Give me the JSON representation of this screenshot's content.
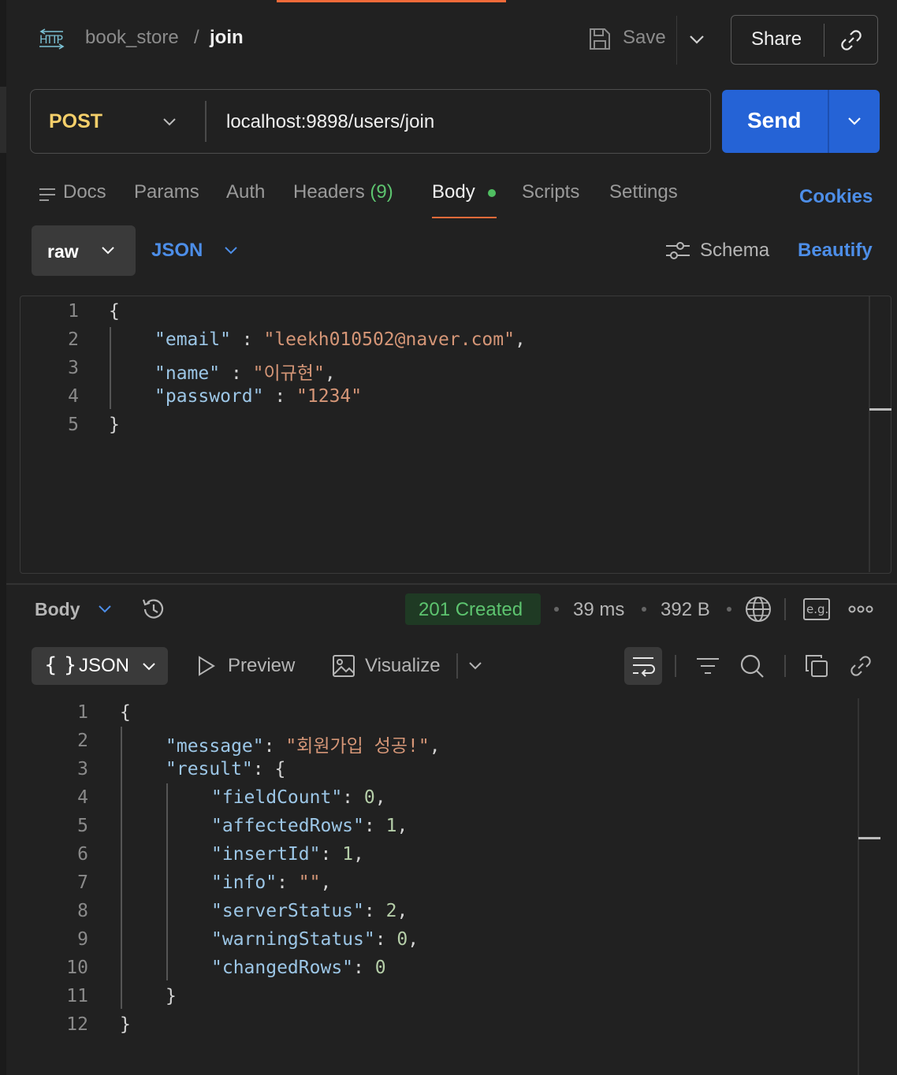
{
  "header": {
    "collection": "book_store",
    "separator": "/",
    "request_name": "join",
    "save_label": "Save",
    "share_label": "Share",
    "protocol_icon": "HTTP"
  },
  "request": {
    "method": "POST",
    "url": "localhost:9898/users/join",
    "send_label": "Send"
  },
  "tabs": {
    "docs": "Docs",
    "params": "Params",
    "auth": "Auth",
    "headers": "Headers",
    "headers_count": "(9)",
    "body": "Body",
    "scripts": "Scripts",
    "settings": "Settings",
    "cookies": "Cookies"
  },
  "body_options": {
    "mode": "raw",
    "format": "JSON",
    "schema": "Schema",
    "beautify": "Beautify"
  },
  "request_body": {
    "line_numbers": [
      "1",
      "2",
      "3",
      "4",
      "5"
    ],
    "lines": {
      "l1": "{",
      "email_key": "\"email\"",
      "email_sep": " : ",
      "email_val": "\"leekh010502@naver.com\"",
      "email_comma": ",",
      "name_key": "\"name\"",
      "name_sep": " : ",
      "name_val": "\"이규현\"",
      "name_comma": ",",
      "pw_key": "\"password\"",
      "pw_sep": " : ",
      "pw_val": "\"1234\"",
      "l5": "}"
    }
  },
  "response": {
    "section_label": "Body",
    "status": "201 Created",
    "time": "39 ms",
    "size": "392 B",
    "eg_label": "e.g.",
    "format": "JSON",
    "format_icon": "{ }",
    "preview": "Preview",
    "visualize": "Visualize",
    "colors": {
      "status_bg": "#1f3a24",
      "status_text": "#5dc46f",
      "accent": "#2563d6",
      "method": "#f4cf6a"
    },
    "line_numbers": [
      "1",
      "2",
      "3",
      "4",
      "5",
      "6",
      "7",
      "8",
      "9",
      "10",
      "11",
      "12"
    ],
    "lines": {
      "l1": "{",
      "message_key": "\"message\"",
      "message_val": "\"회원가입 성공!\"",
      "result_key": "\"result\"",
      "result_open": "{",
      "fieldCount_key": "\"fieldCount\"",
      "fieldCount_val": "0",
      "affectedRows_key": "\"affectedRows\"",
      "affectedRows_val": "1",
      "insertId_key": "\"insertId\"",
      "insertId_val": "1",
      "info_key": "\"info\"",
      "info_val": "\"\"",
      "serverStatus_key": "\"serverStatus\"",
      "serverStatus_val": "2",
      "warningStatus_key": "\"warningStatus\"",
      "warningStatus_val": "0",
      "changedRows_key": "\"changedRows\"",
      "changedRows_val": "0",
      "result_close": "}",
      "l12": "}"
    }
  }
}
